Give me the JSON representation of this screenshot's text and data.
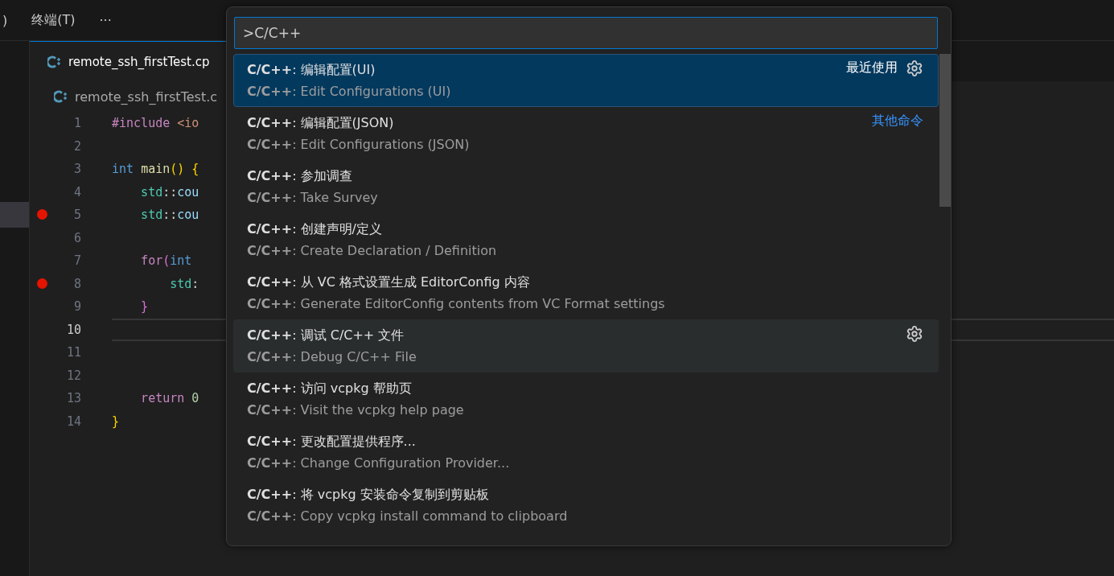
{
  "menubar": {
    "items": [
      ")",
      "终端(T)",
      "···"
    ]
  },
  "sidebar": {
    "selected_row": true
  },
  "tab": {
    "label": "remote_ssh_firstTest.cp",
    "selected": true
  },
  "breadcrumb": {
    "label": "remote_ssh_firstTest.c"
  },
  "editor": {
    "lines": [
      {
        "number": "1",
        "breakpoint": false,
        "current": false,
        "tokens": [
          {
            "text": "#include ",
            "color": "#c586c0"
          },
          {
            "text": "<io",
            "color": "#ce9178"
          }
        ]
      },
      {
        "number": "2",
        "breakpoint": false,
        "current": false
      },
      {
        "number": "3",
        "breakpoint": false,
        "current": false,
        "tokens": [
          {
            "text": "int ",
            "color": "#569cd6"
          },
          {
            "text": "main",
            "color": "#dcdcaa"
          },
          {
            "text": "() {",
            "color": "#ffd700"
          }
        ]
      },
      {
        "number": "4",
        "breakpoint": false,
        "current": false,
        "tokens": [
          {
            "text": "    std",
            "color": "#4ec9b0"
          },
          {
            "text": "::",
            "color": "#d4d4d4"
          },
          {
            "text": "cou",
            "color": "#9cdcfe"
          }
        ]
      },
      {
        "number": "5",
        "breakpoint": true,
        "current": false,
        "tokens": [
          {
            "text": "    std",
            "color": "#4ec9b0"
          },
          {
            "text": "::",
            "color": "#d4d4d4"
          },
          {
            "text": "cou",
            "color": "#9cdcfe"
          }
        ]
      },
      {
        "number": "6",
        "breakpoint": false,
        "current": false
      },
      {
        "number": "7",
        "breakpoint": false,
        "current": false,
        "tokens": [
          {
            "text": "    for",
            "color": "#c586c0"
          },
          {
            "text": "(",
            "color": "#da70d6"
          },
          {
            "text": "int",
            "color": "#569cd6"
          }
        ]
      },
      {
        "number": "8",
        "breakpoint": true,
        "current": false,
        "tokens": [
          {
            "text": "        std",
            "color": "#4ec9b0"
          },
          {
            "text": ":",
            "color": "#d4d4d4"
          }
        ]
      },
      {
        "number": "9",
        "breakpoint": false,
        "current": false,
        "tokens": [
          {
            "text": "    }",
            "color": "#da70d6"
          }
        ]
      },
      {
        "number": "10",
        "breakpoint": false,
        "current": true
      },
      {
        "number": "11",
        "breakpoint": false,
        "current": false
      },
      {
        "number": "12",
        "breakpoint": false,
        "current": false
      },
      {
        "number": "13",
        "breakpoint": false,
        "current": false,
        "tokens": [
          {
            "text": "    return ",
            "color": "#c586c0"
          },
          {
            "text": "0",
            "color": "#b5cea8"
          }
        ]
      },
      {
        "number": "14",
        "breakpoint": false,
        "current": false,
        "tokens": [
          {
            "text": "}",
            "color": "#ffd700"
          }
        ]
      }
    ]
  },
  "palette": {
    "input": {
      "value": ">C/C++"
    },
    "items": [
      {
        "label": "**C/C++**: 编辑配置(UI)",
        "detail": "**C/C++**: Edit Configurations (UI)",
        "group": "最近使用",
        "gear": true,
        "selected": true,
        "hovered": false
      },
      {
        "label": "**C/C++**: 编辑配置(JSON)",
        "detail": "**C/C++**: Edit Configurations (JSON)",
        "group": "其他命令",
        "gear": false,
        "selected": false,
        "hovered": false
      },
      {
        "label": "**C/C++**: 参加调查",
        "detail": "**C/C++**: Take Survey",
        "gear": false,
        "selected": false,
        "hovered": false
      },
      {
        "label": "**C/C++**: 创建声明/定义",
        "detail": "**C/C++**: Create Declaration / Definition",
        "gear": false,
        "selected": false,
        "hovered": false
      },
      {
        "label": "**C/C++**: 从 VC 格式设置生成 EditorConfig 内容",
        "detail": "**C/C++**: Generate EditorConfig contents from VC Format settings",
        "gear": false,
        "selected": false,
        "hovered": false
      },
      {
        "label": "**C/C++**: 调试 C/C++ 文件",
        "detail": "**C/C++**: Debug C/C++ File",
        "gear": true,
        "selected": false,
        "hovered": true
      },
      {
        "label": "**C/C++**: 访问 vcpkg 帮助页",
        "detail": "**C/C++**: Visit the vcpkg help page",
        "gear": false,
        "selected": false,
        "hovered": false
      },
      {
        "label": "**C/C++**: 更改配置提供程序...",
        "detail": "**C/C++**: Change Configuration Provider...",
        "gear": false,
        "selected": false,
        "hovered": false
      },
      {
        "label": "**C/C++**: 将 vcpkg 安装命令复制到剪贴板",
        "detail": "**C/C++**: Copy vcpkg install command to clipboard",
        "gear": false,
        "selected": false,
        "hovered": false
      }
    ]
  }
}
